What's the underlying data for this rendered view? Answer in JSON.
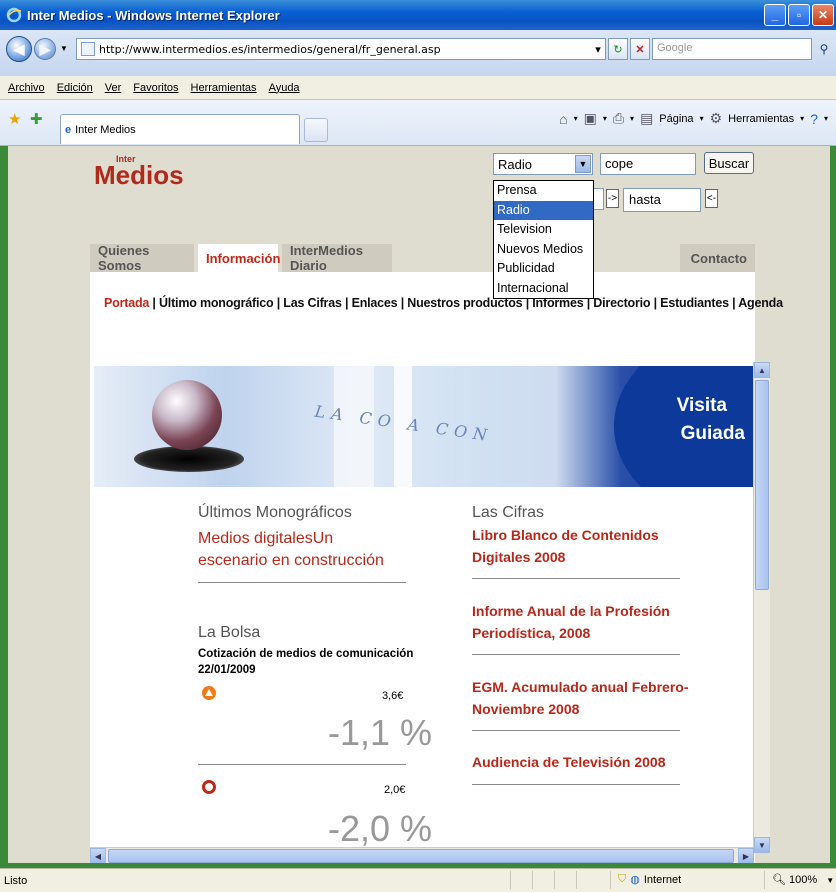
{
  "window": {
    "title": "Inter Medios - Windows Internet Explorer",
    "url": "http://www.intermedios.es/intermedios/general/fr_general.asp",
    "search_placeholder": "Google"
  },
  "menu": [
    "Archivo",
    "Edición",
    "Ver",
    "Favoritos",
    "Herramientas",
    "Ayuda"
  ],
  "tab_title": "Inter Medios",
  "commands": {
    "page": "Página",
    "tools": "Herramientas"
  },
  "page": {
    "logo_inter": "Inter",
    "logo_medios": "Medios",
    "search": {
      "selected": "Radio",
      "query": "cope",
      "button": "Buscar",
      "to_value": "hasta",
      "arrow_right": "->",
      "arrow_left": "<-"
    },
    "dropdown_options": [
      "Prensa",
      "Radio",
      "Television",
      "Nuevos Medios",
      "Publicidad",
      "Internacional"
    ],
    "nav_tabs": {
      "quienes": "Quienes Somos",
      "informacion": "Información",
      "diario": "InterMedios Diario",
      "contacto": "Contacto"
    },
    "subnav": {
      "portada": "Portada",
      "rest": " | Último monográfico | Las Cifras | Enlaces | Nuestros productos | Informes | Directorio | Estudiantes | Agenda"
    },
    "banner": {
      "text": "LA CO A CON",
      "visita": "Visita",
      "guiada": "Guiada"
    },
    "monograficos": {
      "heading": "Últimos Monográficos",
      "link": "Medios digitalesUn escenario en construcción"
    },
    "bolsa": {
      "heading": "La Bolsa",
      "subtitle": "Cotización de medios de comunicación",
      "date": "22/01/2009",
      "stocks": [
        {
          "price": "3,6€",
          "change": "-1,1 %"
        },
        {
          "price": "2,0€",
          "change": "-2,0 %"
        }
      ]
    },
    "cifras": {
      "heading": "Las Cifras",
      "items": [
        "Libro Blanco de Contenidos Digitales 2008",
        "Informe Anual de la Profesión Periodística, 2008",
        "EGM. Acumulado anual Febrero-Noviembre 2008",
        "Audiencia de Televisión 2008"
      ]
    }
  },
  "status": {
    "text": "Listo",
    "zone": "Internet",
    "zoom": "100%"
  }
}
